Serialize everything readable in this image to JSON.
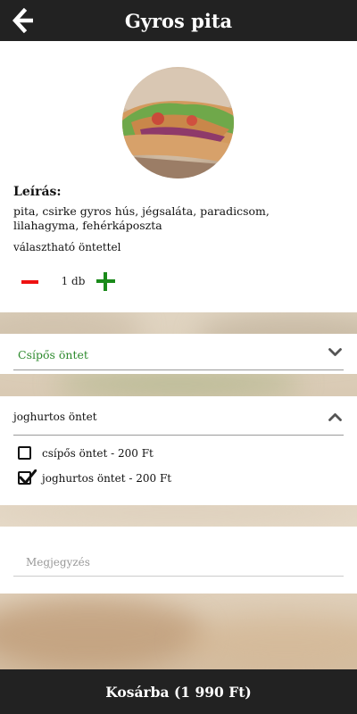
{
  "header": {
    "title": "Gyros pita",
    "back_icon": "arrow-left-icon"
  },
  "product": {
    "image_alt": "gyros pita photo",
    "description_title": "Leírás:",
    "description": "pita, csirke gyros hús, jégsaláta, paradicsom, lilahagyma, fehérkáposzta",
    "sauce_note": "választható öntettel",
    "quantity": {
      "value": "1 db",
      "minus_icon": "minus-icon",
      "plus_icon": "plus-icon",
      "minus_color": "#e11111",
      "plus_color": "#1a8a1a"
    }
  },
  "sauce_dropdown": {
    "selected": "Csípős öntet",
    "label_color": "#2d8a2d",
    "icon": "chevron-down-icon"
  },
  "sauce_options": {
    "title": "joghurtos öntet",
    "icon": "chevron-up-icon",
    "options": [
      {
        "label": "csípős öntet - 200 Ft",
        "checked": false
      },
      {
        "label": "joghurtos öntet - 200 Ft",
        "checked": true
      }
    ]
  },
  "note": {
    "placeholder": "Megjegyzés",
    "value": ""
  },
  "cart": {
    "label": "Kosárba (1 990 Ft)"
  },
  "colors": {
    "bar_background": "#222222",
    "accent_green": "#2d8a2d",
    "minus_red": "#e11111"
  }
}
